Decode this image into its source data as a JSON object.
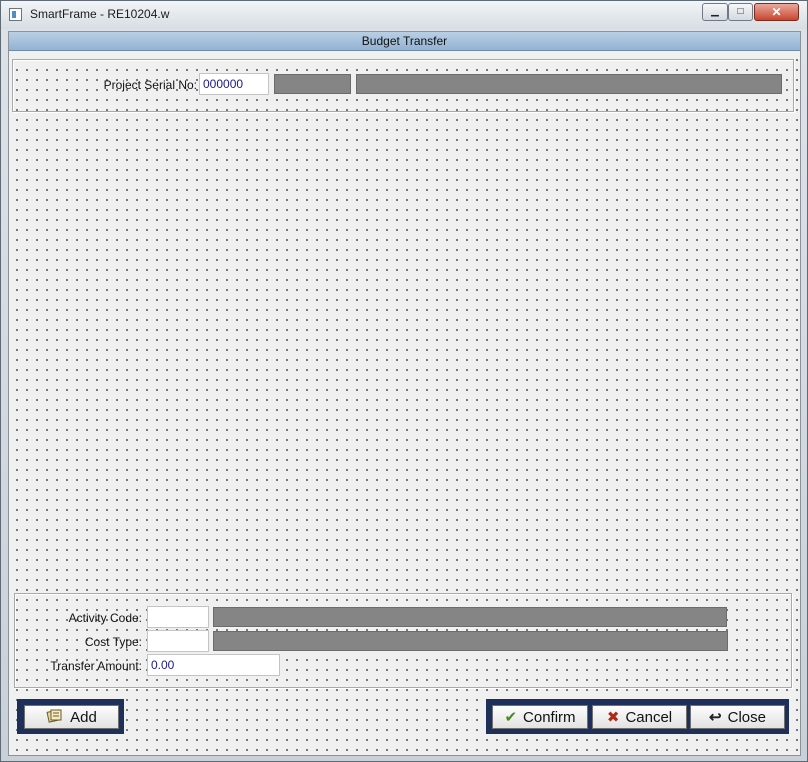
{
  "window": {
    "title": "SmartFrame - RE10204.w",
    "minimize_glyph": "▁",
    "maximize_glyph": "□",
    "close_glyph": "✕"
  },
  "header": {
    "title": "Budget Transfer"
  },
  "project": {
    "serial_label": "Project Serial No:",
    "serial_value": "000000"
  },
  "detail": {
    "activity_code_label": "Activity Code:",
    "activity_code_value": "",
    "cost_type_label": "Cost Type:",
    "cost_type_value": "",
    "transfer_amount_label": "Transfer Amount:",
    "transfer_amount_value": "0.00"
  },
  "buttons": {
    "add": {
      "label": "Add",
      "icon": "notebook-icon"
    },
    "confirm": {
      "label": "Confirm",
      "icon": "checkmark-icon",
      "glyph": "✔"
    },
    "cancel": {
      "label": "Cancel",
      "icon": "x-icon",
      "glyph": "✖"
    },
    "close": {
      "label": "Close",
      "icon": "return-arrow-icon",
      "glyph": "↩"
    }
  },
  "colors": {
    "header_bar": "#a9c3dd",
    "button_frame": "#1e2f5a",
    "readonly_field": "#858585",
    "value_text": "#1a1a8c",
    "confirm_icon": "#4a8a1c",
    "cancel_icon": "#b02a1a"
  }
}
